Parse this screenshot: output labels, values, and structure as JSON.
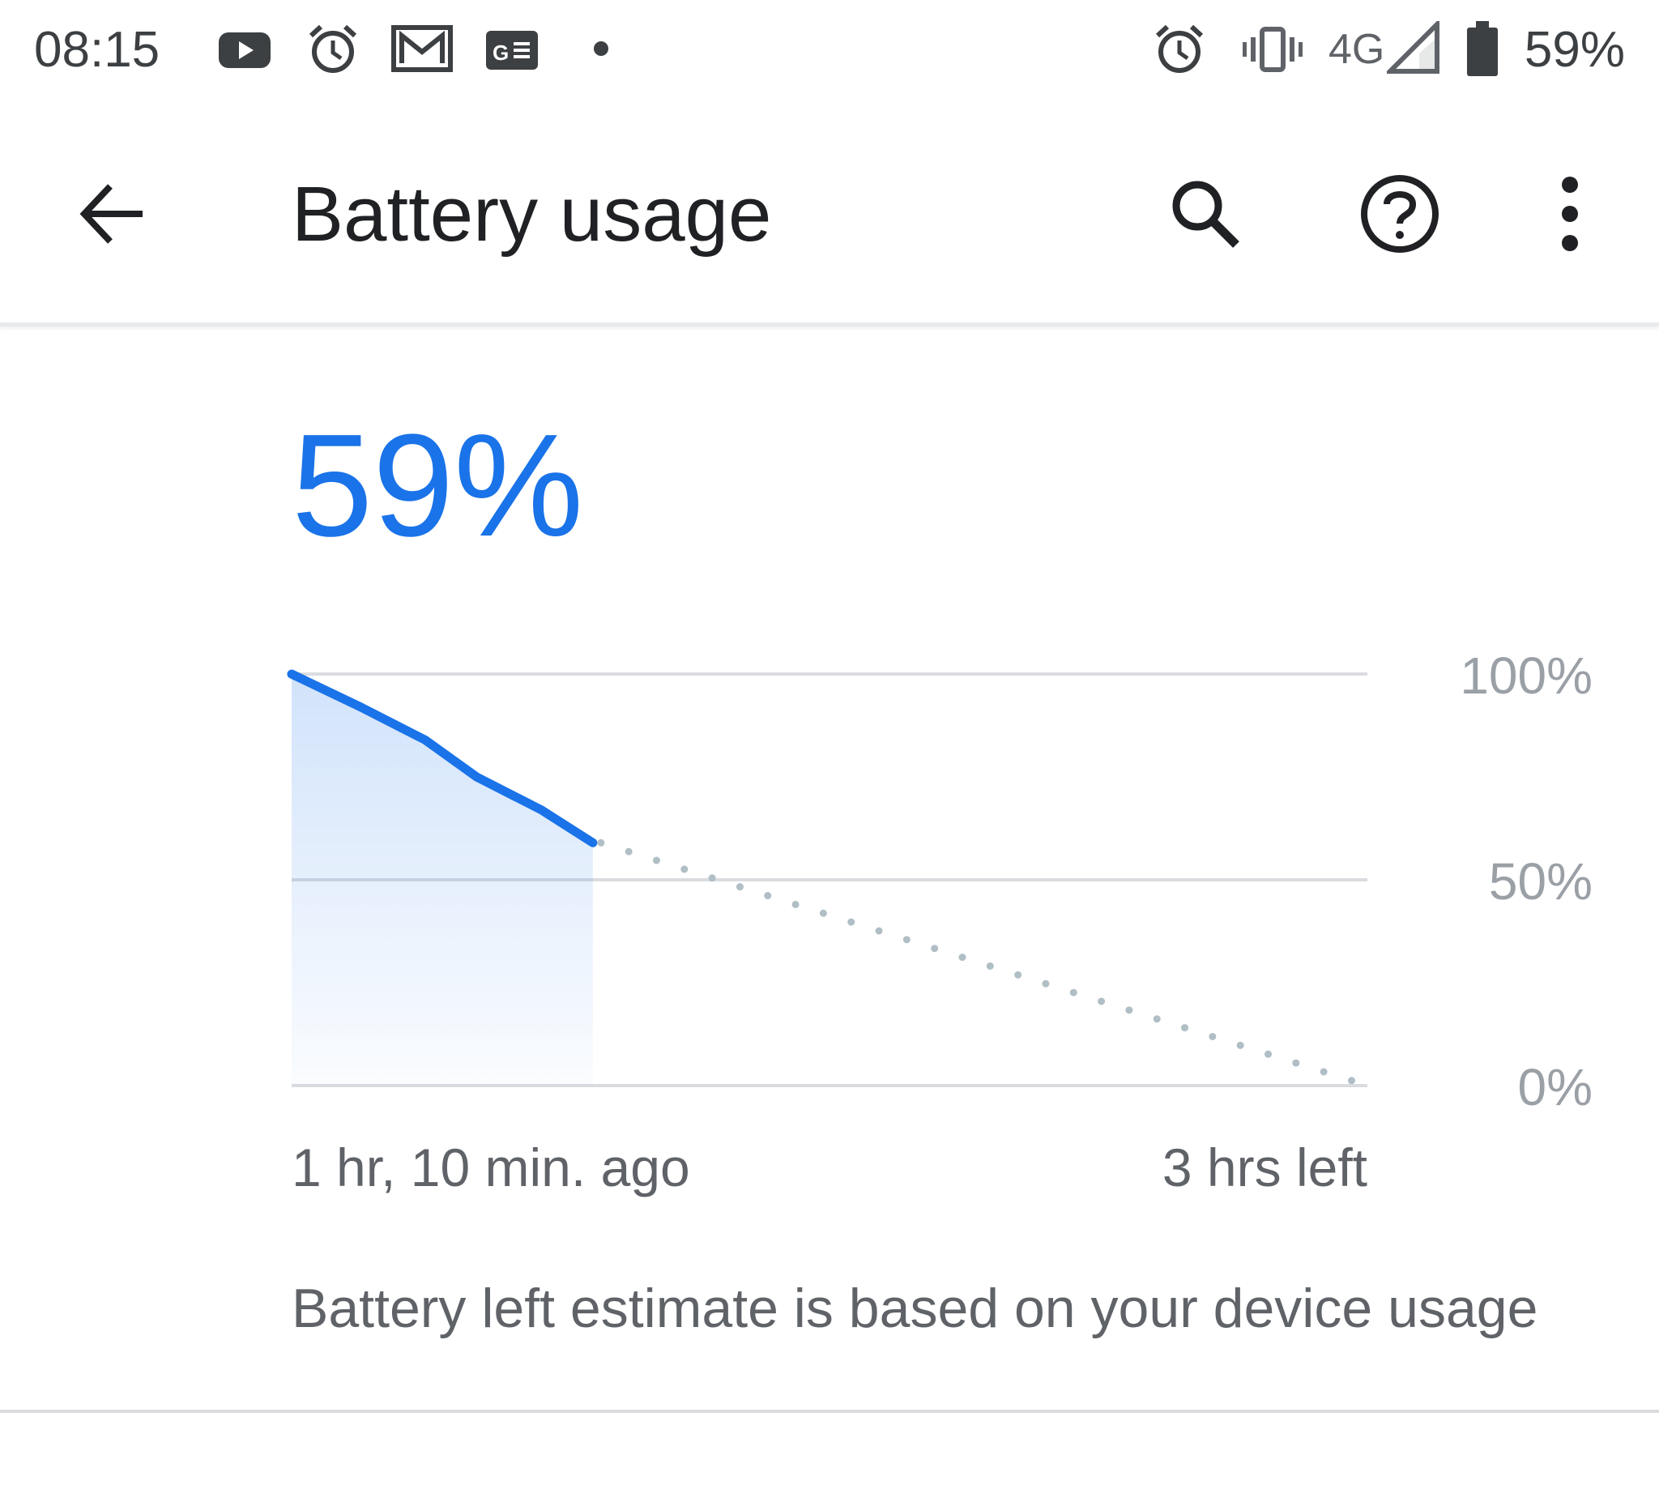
{
  "status_bar": {
    "time": "08:15",
    "notification_icons": [
      "youtube-icon",
      "alarm-icon",
      "gmail-icon",
      "news-icon",
      "more-dot-icon"
    ],
    "system_icons": [
      "alarm-icon",
      "vibrate-icon",
      "signal-icon",
      "battery-icon"
    ],
    "network": "4G",
    "battery_percent": "59%"
  },
  "app_bar": {
    "title": "Battery usage",
    "actions": [
      "search-icon",
      "help-icon",
      "overflow-menu-icon"
    ]
  },
  "battery": {
    "level": "59%",
    "caption": "Battery left estimate is based on your device usage"
  },
  "colors": {
    "accent": "#1a73e8",
    "grid": "#dadce0",
    "projection": "#b0bec5"
  },
  "chart_data": {
    "type": "line",
    "x_axis_labels": [
      "1 hr, 10 min. ago",
      "3 hrs left"
    ],
    "y_ticks": [
      "100%",
      "50%",
      "0%"
    ],
    "ylim": [
      0,
      100
    ],
    "xlim_hours": [
      -1.1667,
      3
    ],
    "series": [
      {
        "style": "solid-filled",
        "x_hours": [
          -1.1667,
          -0.9,
          -0.65,
          -0.45,
          -0.2,
          0
        ],
        "y": [
          100,
          92,
          84,
          75,
          67,
          59
        ]
      },
      {
        "style": "dotted-projection",
        "x_hours": [
          0,
          3
        ],
        "y": [
          59,
          0
        ]
      }
    ]
  }
}
